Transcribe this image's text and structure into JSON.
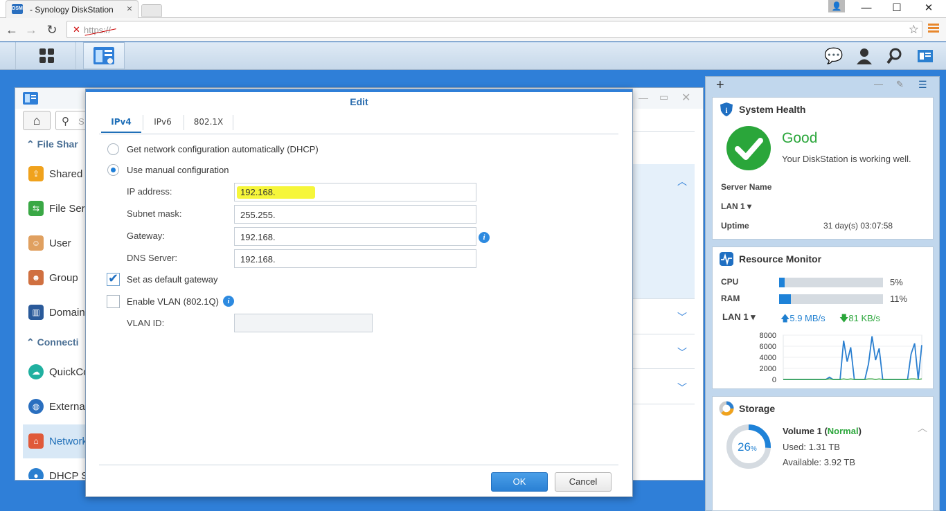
{
  "browser": {
    "tab_title": "- Synology DiskStation",
    "tab_favicon": "DSM",
    "tab_close": "×",
    "url": "https://",
    "window_controls": [
      "—",
      "☐",
      "✕"
    ]
  },
  "taskbar": {
    "icons": [
      "main-menu-icon",
      "control-panel-icon",
      "messages-icon",
      "user-icon",
      "search-icon",
      "widgets-icon"
    ]
  },
  "control_panel": {
    "search_placeholder": "S",
    "sections": [
      {
        "label": "File Shar"
      },
      {
        "label": "Connecti"
      }
    ],
    "items": [
      {
        "label": "Shared",
        "icon": "shared-folder-icon",
        "color": "#f0a21c"
      },
      {
        "label": "File Ser",
        "icon": "file-services-icon",
        "color": "#3aa845"
      },
      {
        "label": "User",
        "icon": "user-icon",
        "color": "#e0a060"
      },
      {
        "label": "Group",
        "icon": "group-icon",
        "color": "#d07040"
      },
      {
        "label": "Domain",
        "icon": "domain-icon",
        "color": "#2a5a9a"
      },
      {
        "label": "QuickCo",
        "icon": "quickconnect-icon",
        "color": "#20b0a0"
      },
      {
        "label": "Externa",
        "icon": "external-access-icon",
        "color": "#2a6fbf"
      },
      {
        "label": "Network",
        "icon": "network-icon",
        "color": "#e05a3a"
      },
      {
        "label": "DHCP S",
        "icon": "dhcp-icon",
        "color": "#2a7fd0"
      }
    ]
  },
  "dialog": {
    "title": "Edit",
    "tabs": [
      "IPv4",
      "IPv6",
      "802.1X"
    ],
    "selected_tab": "IPv4",
    "options": {
      "dhcp": "Get network configuration automatically (DHCP)",
      "manual": "Use manual configuration"
    },
    "selected_option": "manual",
    "fields": {
      "ip_label": "IP address:",
      "ip_value": "192.168.",
      "subnet_label": "Subnet mask:",
      "subnet_value": "255.255.",
      "gateway_label": "Gateway:",
      "gateway_value": "192.168.",
      "dns_label": "DNS Server:",
      "dns_value": "192.168."
    },
    "default_gateway": {
      "label": "Set as default gateway",
      "checked": true
    },
    "vlan": {
      "label": "Enable VLAN (802.1Q)",
      "checked": false,
      "id_label": "VLAN ID:",
      "id_value": ""
    },
    "info_glyph": "i",
    "ok": "OK",
    "cancel": "Cancel"
  },
  "widgets": {
    "toolbar": {
      "add": "+",
      "minimize": "—",
      "pin": "📌",
      "menu": "☰"
    },
    "health": {
      "title": "System Health",
      "status": "Good",
      "message": "Your DiskStation is working well.",
      "server_name_label": "Server Name",
      "lan_label": "LAN 1",
      "uptime_label": "Uptime",
      "uptime_value": "31 day(s) 03:07:58",
      "color": "#2aa63a"
    },
    "resource": {
      "title": "Resource Monitor",
      "cpu_label": "CPU",
      "cpu_percent": 5,
      "cpu_text": "5%",
      "ram_label": "RAM",
      "ram_percent": 11,
      "ram_text": "11%",
      "lan_label": "LAN 1",
      "upload": "5.9 MB/s",
      "download": "81 KB/s"
    },
    "storage": {
      "title": "Storage",
      "volume": "Volume 1",
      "status": "Normal",
      "used": "Used: 1.31 TB",
      "available": "Available: 3.92 TB",
      "percent": 26,
      "percent_text": "26",
      "percent_unit": "%"
    }
  },
  "chart_data": {
    "type": "line",
    "yticks": [
      8000,
      6000,
      4000,
      2000,
      0
    ],
    "ylim": [
      0,
      8000
    ],
    "series": [
      {
        "color": "#2a7fd0",
        "values": [
          0,
          0,
          0,
          0,
          0,
          0,
          0,
          0,
          0,
          0,
          0,
          0,
          0,
          400,
          0,
          0,
          0,
          7000,
          3200,
          5800,
          0,
          0,
          0,
          0,
          2800,
          7800,
          3500,
          5600,
          0,
          0,
          0,
          0,
          0,
          0,
          0,
          0,
          4600,
          6500,
          0,
          6200
        ]
      },
      {
        "color": "#3aa845",
        "values": [
          0,
          0,
          0,
          0,
          0,
          0,
          0,
          0,
          0,
          0,
          0,
          0,
          0,
          100,
          0,
          0,
          0,
          100,
          0,
          100,
          0,
          0,
          0,
          0,
          100,
          100,
          0,
          100,
          0,
          0,
          0,
          0,
          0,
          0,
          0,
          0,
          100,
          100,
          0,
          100
        ]
      }
    ]
  }
}
